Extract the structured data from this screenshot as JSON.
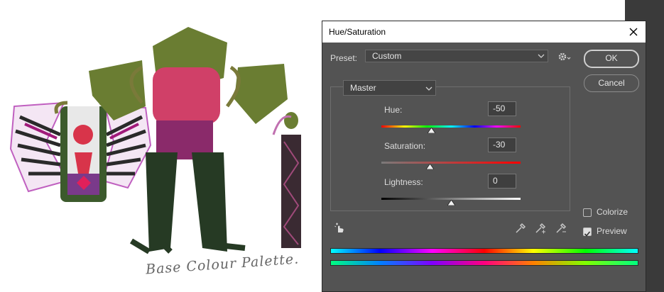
{
  "canvas": {
    "caption": "Base Colour Palette."
  },
  "dialog": {
    "title": "Hue/Saturation",
    "preset_label": "Preset:",
    "preset_value": "Custom",
    "channel_value": "Master",
    "ok_label": "OK",
    "cancel_label": "Cancel",
    "hue": {
      "label": "Hue:",
      "value": "-50",
      "fraction": 0.36
    },
    "saturation": {
      "label": "Saturation:",
      "value": "-30",
      "fraction": 0.35
    },
    "lightness": {
      "label": "Lightness:",
      "value": "0",
      "fraction": 0.5
    },
    "colorize": {
      "label": "Colorize",
      "checked": false
    },
    "preview": {
      "label": "Preview",
      "checked": true
    }
  }
}
